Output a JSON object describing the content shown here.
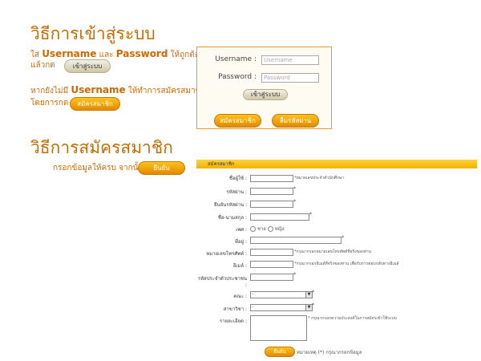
{
  "login_section": {
    "title": "วิธีการเข้าสู่ระบบ",
    "line1_prefix": "ใส่",
    "line1_username": "Username",
    "line1_and": "และ",
    "line1_password": "Password",
    "line1_suffix": "ให้ถูกต้อง",
    "line2_prefix": "แล้วกด",
    "login_button": "เข้าสู่ระบบ",
    "line3_prefix": "หากยังไม่มี",
    "line3_username": "Username",
    "line3_suffix": "ให้ทำการสมัครสมาชิก",
    "line4_prefix": "โดยการกด",
    "register_button": "สมัครสมาชิก"
  },
  "login_box": {
    "username_label": "Username :",
    "username_placeholder": "Username",
    "password_label": "Password :",
    "password_placeholder": "Password",
    "login_button": "เข้าสู่ระบบ",
    "register_button": "สมัครสมาชิก",
    "forgot_button": "ลืมรหัสผ่าน"
  },
  "register_section": {
    "title": "วิธีการสมัครสมาชิก",
    "instruction": "กรอกข้อมูลให้ครบ จากนั้นกด",
    "confirm_button": "ยืนยัน"
  },
  "form": {
    "header": "สมัครสมาชิก",
    "fields": {
      "username_label": "ชื่อผู้ใช้ :",
      "username_note": "*หมายเลขประจำตัวนักศึกษา",
      "password_label": "รหัสผ่าน :",
      "password_confirm_label": "ยืนยันรหัสผ่าน :",
      "fullname_label": "ชื่อ-นามสกุล :",
      "gender_label": "เพศ :",
      "gender_male": "ชาย",
      "gender_female": "หญิง",
      "address_label": "ที่อยู่ :",
      "phone_label": "หมายเลขโทรศัพท์ :",
      "phone_note": "*กรุณากรอกหมายเลขโทรศัพท์ที่จริงของท่าน",
      "email_label": "อีเมล์ :",
      "email_note": "*กรุณากรอกอีเมล์ที่จริงของท่าน เพื่อรับการตอบกลับทางอีเมล์",
      "idcard_label": "รหัสประจำตัวประชาชน :",
      "faculty_label": "คณะ :",
      "faculty_value": "-",
      "major_label": "สาขาวิชา :",
      "major_value": "-",
      "details_label": "รายละเอียด :",
      "details_note": "* กรุณากรอกความประสงค์ในการสมัครเข้าใช้ระบบ",
      "star": "*"
    },
    "submit_button": "ยืนยัน",
    "footer_note": "หมายเหตุ (*) กรุณากรอกข้อมูล"
  },
  "colors": {
    "title_orange": "#c26d00",
    "text_orange": "#d06800",
    "header_yellow": "#f2b000",
    "box_border": "#e89a2a"
  }
}
